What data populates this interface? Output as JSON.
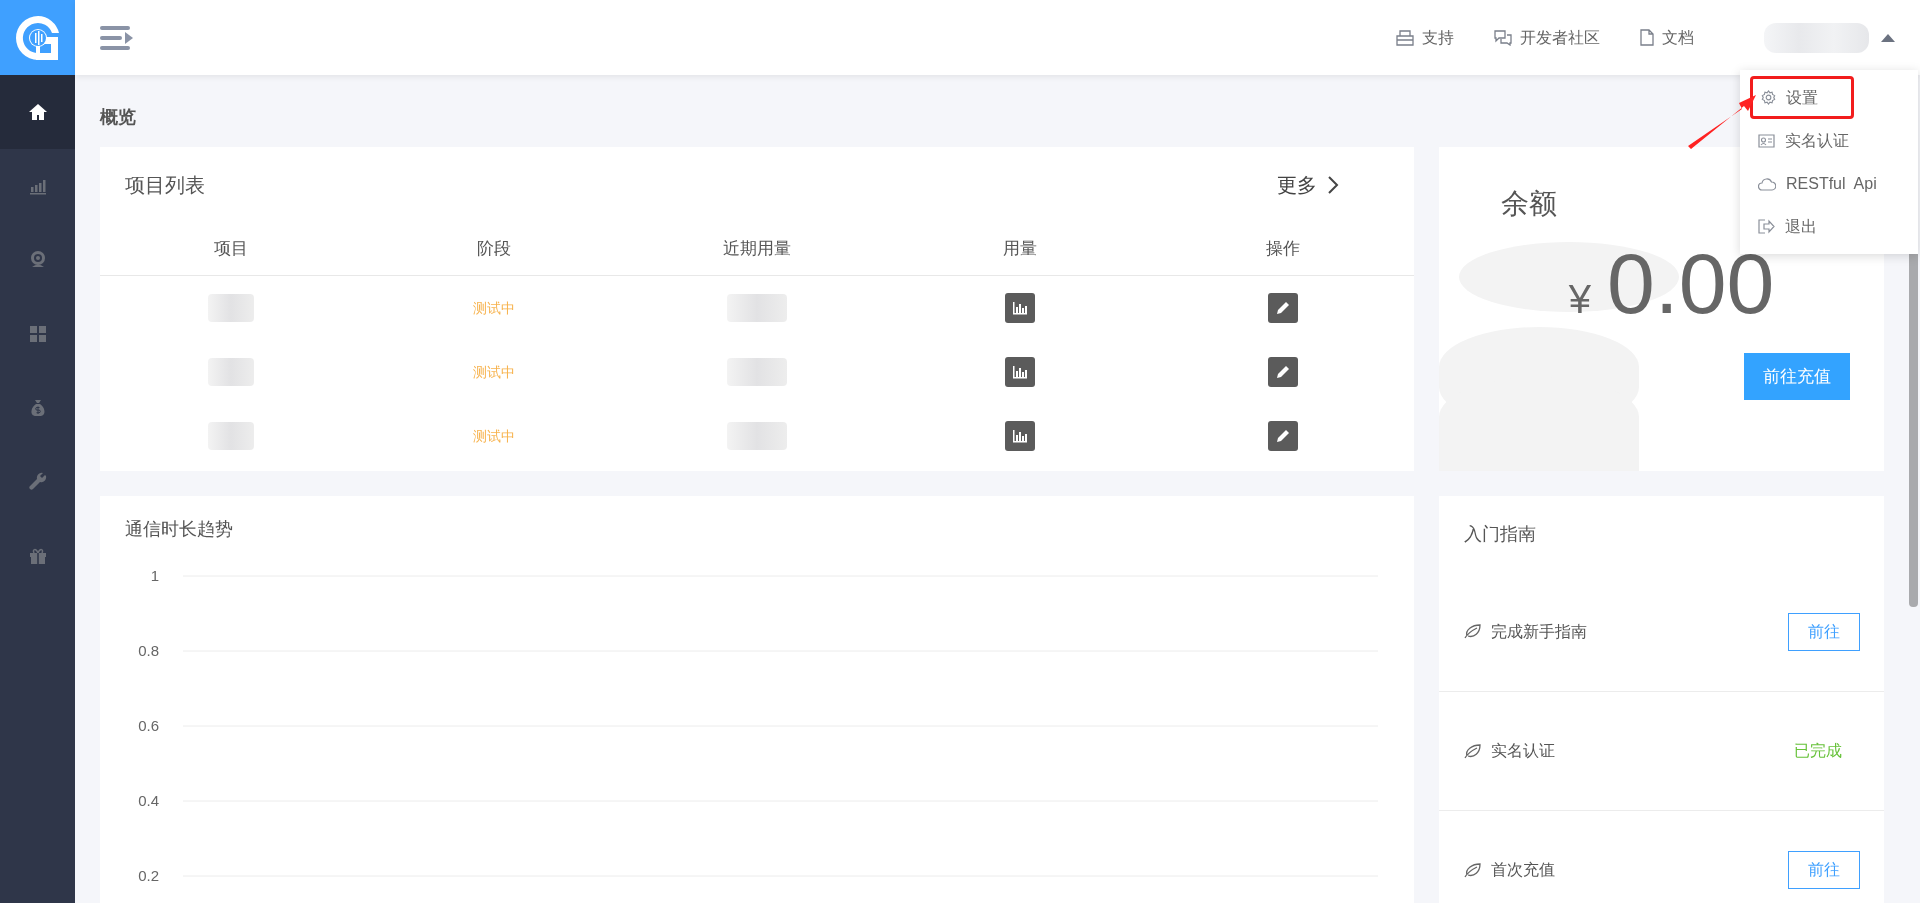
{
  "sidebar": {
    "items": [
      {
        "kind": "home",
        "selected": true
      },
      {
        "kind": "chart",
        "selected": false
      },
      {
        "kind": "webcam",
        "selected": false
      },
      {
        "kind": "grid",
        "selected": false
      },
      {
        "kind": "moneybag",
        "selected": false
      },
      {
        "kind": "wrench",
        "selected": false
      },
      {
        "kind": "gift",
        "selected": false
      }
    ]
  },
  "header": {
    "links": [
      {
        "kind": "support",
        "label": "支持"
      },
      {
        "kind": "community",
        "label": "开发者社区"
      },
      {
        "kind": "docs",
        "label": "文档"
      }
    ]
  },
  "user_menu": {
    "expanded": true,
    "items": [
      {
        "kind": "settings",
        "label": "设置",
        "annotated": true
      },
      {
        "kind": "id_card",
        "label": "实名认证",
        "annotated": false
      },
      {
        "kind": "api",
        "label": "RESTful  Api",
        "annotated": false
      },
      {
        "kind": "logout",
        "label": "退出",
        "annotated": false
      }
    ]
  },
  "page_title": "概览",
  "projects": {
    "title": "项目列表",
    "more": "更多",
    "columns": [
      "项目",
      "阶段",
      "近期用量",
      "用量",
      "操作"
    ],
    "rows": [
      {
        "stage": "测试中"
      },
      {
        "stage": "测试中"
      },
      {
        "stage": "测试中"
      }
    ]
  },
  "balance": {
    "title": "余额",
    "currency": "¥",
    "amount": "0.00",
    "button": "前往充值"
  },
  "chart": {
    "title": "通信时长趋势",
    "axis_labels": [
      "1",
      "0.8",
      "0.6",
      "0.4",
      "0.2"
    ]
  },
  "guide": {
    "title": "入门指南",
    "items": [
      {
        "label": "完成新手指南",
        "done": false,
        "action": "前往"
      },
      {
        "label": "实名认证",
        "done": true,
        "status": "已完成"
      },
      {
        "label": "首次充值",
        "done": false,
        "action": "前往"
      }
    ]
  }
}
